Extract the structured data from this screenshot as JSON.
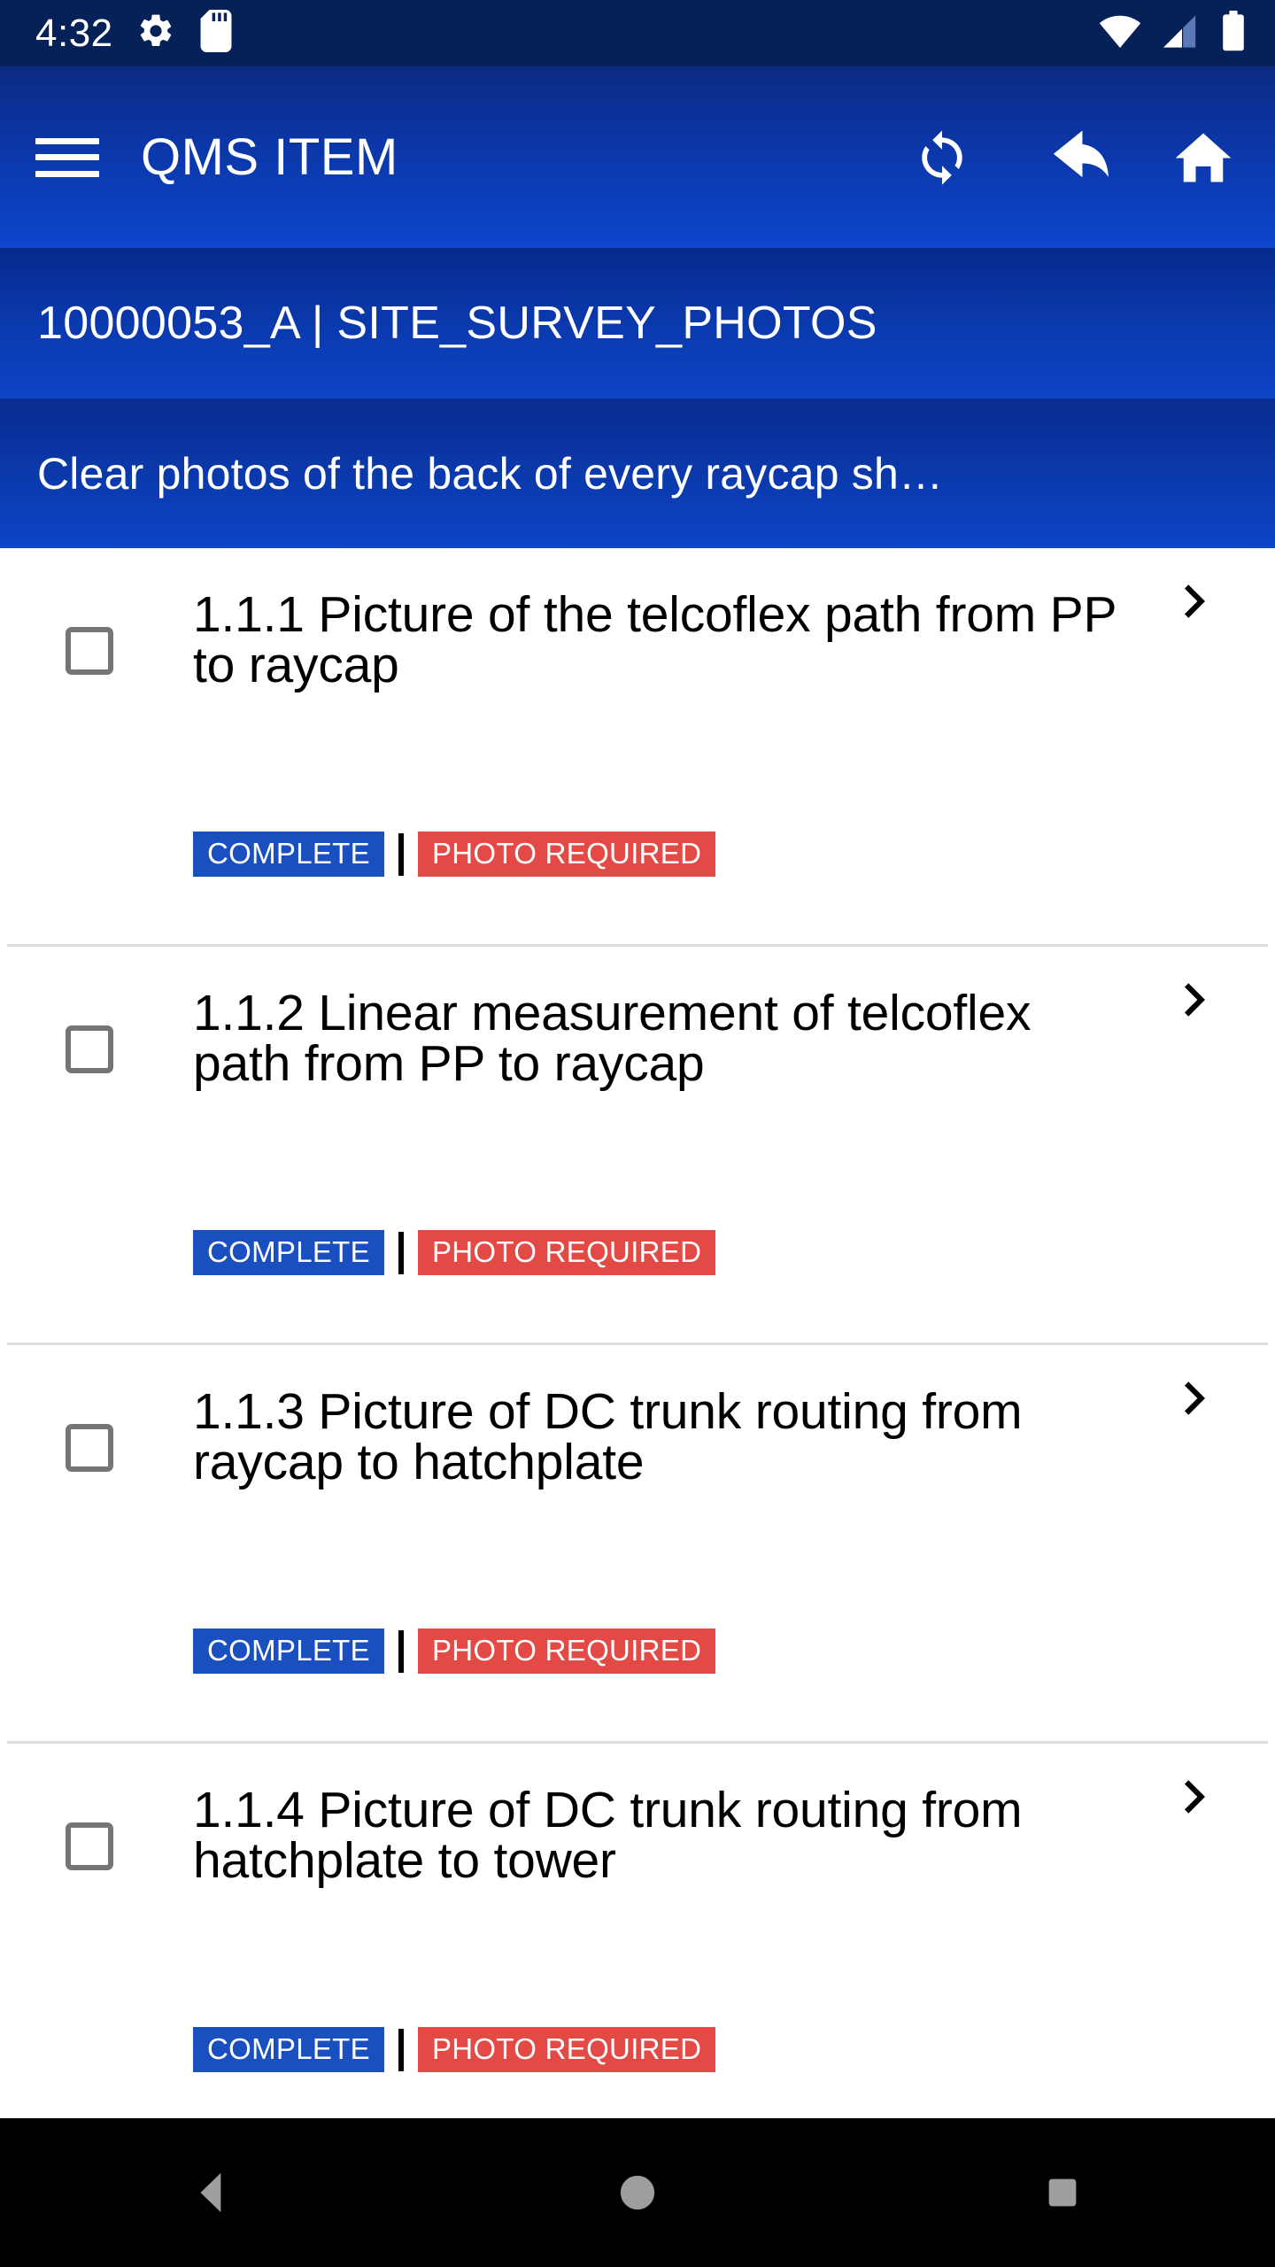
{
  "status_bar": {
    "time": "4:32",
    "icons_left": [
      "settings-gear-icon",
      "sd-card-icon"
    ],
    "icons_right": [
      "wifi-icon",
      "cellular-signal-icon",
      "battery-icon"
    ],
    "background_color": "#062157"
  },
  "app_bar": {
    "menu_icon": "hamburger-menu-icon",
    "title": "QMS ITEM",
    "actions": [
      {
        "name": "sync-icon",
        "label": "Sync"
      },
      {
        "name": "reply-back-icon",
        "label": "Back"
      },
      {
        "name": "home-icon",
        "label": "Home"
      }
    ],
    "background_color": "#0d46cd"
  },
  "sub_header": {
    "item_id": "10000053_A | SITE_SURVEY_PHOTOS",
    "description": "Clear photos of the back of every raycap sh…"
  },
  "list": {
    "badge_separator": "|",
    "items": [
      {
        "checked": false,
        "title": "1.1.1 Picture of the telcoflex path from PP to raycap",
        "status_badge": "COMPLETE",
        "requirement_badge": "PHOTO REQUIRED"
      },
      {
        "checked": false,
        "title": "1.1.2 Linear measurement of telcoflex path from PP to raycap",
        "status_badge": "COMPLETE",
        "requirement_badge": "PHOTO REQUIRED"
      },
      {
        "checked": false,
        "title": "1.1.3 Picture of DC trunk routing from raycap to hatchplate",
        "status_badge": "COMPLETE",
        "requirement_badge": "PHOTO REQUIRED"
      },
      {
        "checked": false,
        "title": "1.1.4 Picture of DC trunk routing from hatchplate to tower",
        "status_badge": "COMPLETE",
        "requirement_badge": "PHOTO REQUIRED"
      }
    ]
  },
  "nav_bar": {
    "buttons": [
      {
        "name": "android-back-button",
        "label": "Back"
      },
      {
        "name": "android-home-button",
        "label": "Home"
      },
      {
        "name": "android-recents-button",
        "label": "Recents"
      }
    ],
    "background_color": "#000000"
  },
  "colors": {
    "status_bar": "#062157",
    "app_bar": "#0d46cd",
    "complete_badge": "#1A4FC0",
    "photo_required_badge": "#E34A46",
    "checkbox_border": "#757575",
    "separator": "#dedede"
  }
}
